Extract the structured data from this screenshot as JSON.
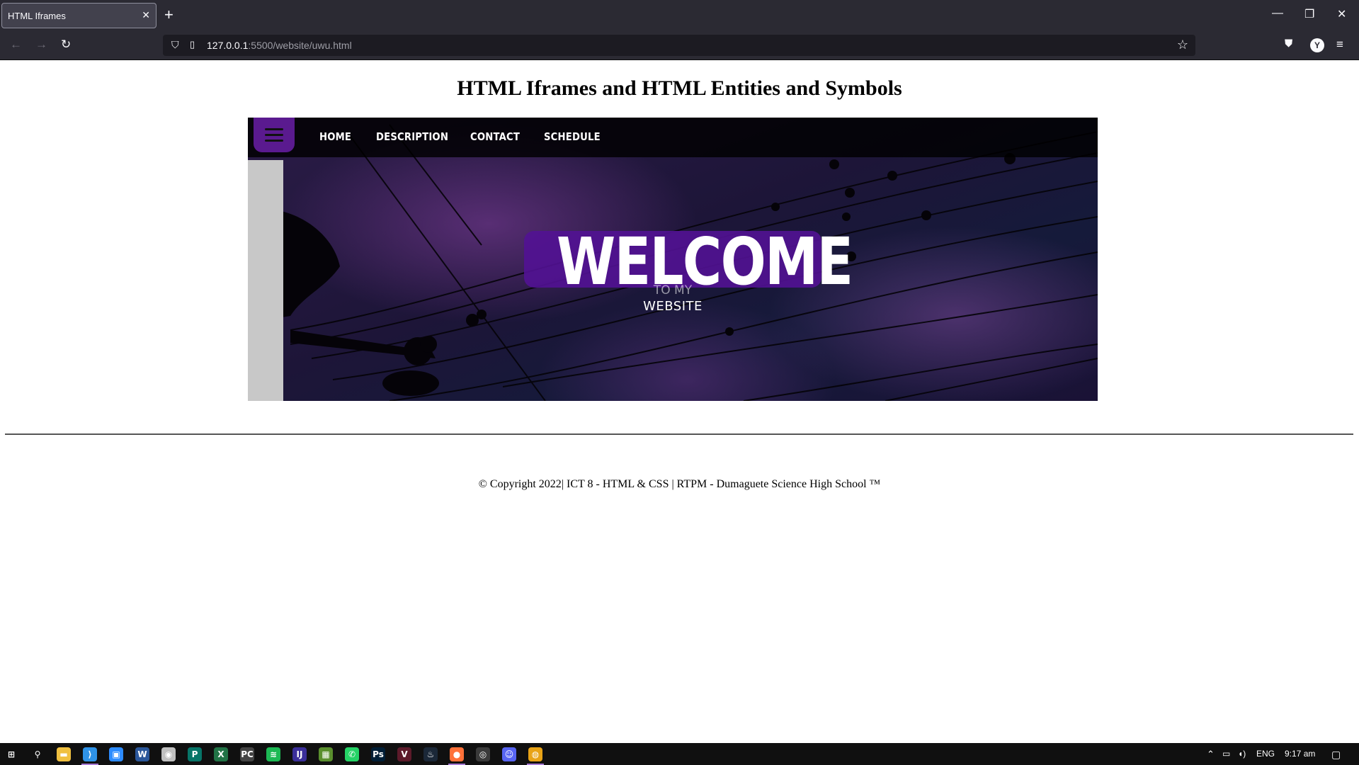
{
  "browser": {
    "tab_title": "HTML Iframes",
    "tab_close": "✕",
    "new_tab": "+",
    "url_host": "127.0.0.1",
    "url_path": ":5500/website/uwu.html",
    "avatar_letter": "Y",
    "window_controls": {
      "minimize": "—",
      "restore": "❐",
      "close": "✕"
    }
  },
  "page": {
    "title": "HTML Iframes and HTML Entities and Symbols",
    "nav": [
      "HOME",
      "DESCRIPTION",
      "CONTACT",
      "SCHEDULE"
    ],
    "hero_title": "WELCOME",
    "hero_sub1": "TO MY",
    "hero_sub2": "WEBSITE",
    "footer": "© Copyright 2022| ICT 8 - HTML & CSS | RTPM - Dumaguete Science High School ™"
  },
  "taskbar": {
    "apps": [
      {
        "name": "start-icon",
        "glyph": "⊞",
        "color": "#ffffff"
      },
      {
        "name": "search-icon",
        "glyph": "⚲",
        "color": "#ffffff"
      },
      {
        "name": "file-explorer-icon",
        "glyph": "▬",
        "color": "#f0c040"
      },
      {
        "name": "vscode-icon",
        "glyph": "⟩",
        "color": "#2f93e8"
      },
      {
        "name": "zoom-icon",
        "glyph": "▣",
        "color": "#2d8cff"
      },
      {
        "name": "word-icon",
        "glyph": "W",
        "color": "#2b579a"
      },
      {
        "name": "davinci-icon",
        "glyph": "◉",
        "color": "#c0c0c0"
      },
      {
        "name": "publisher-icon",
        "glyph": "P",
        "color": "#077568"
      },
      {
        "name": "excel-icon",
        "glyph": "X",
        "color": "#217346"
      },
      {
        "name": "pycharm-icon",
        "glyph": "PC",
        "color": "#444444"
      },
      {
        "name": "spotify-icon",
        "glyph": "≋",
        "color": "#1db954"
      },
      {
        "name": "intellij-icon",
        "glyph": "IJ",
        "color": "#3b2f9a"
      },
      {
        "name": "minecraft-icon",
        "glyph": "▦",
        "color": "#5a8f2e"
      },
      {
        "name": "whatsapp-icon",
        "glyph": "✆",
        "color": "#25d366"
      },
      {
        "name": "photoshop-icon",
        "glyph": "Ps",
        "color": "#001e36"
      },
      {
        "name": "app-v-icon",
        "glyph": "V",
        "color": "#5c1a2a"
      },
      {
        "name": "steam-icon",
        "glyph": "♨",
        "color": "#1b2838"
      },
      {
        "name": "firefox-icon",
        "glyph": "●",
        "color": "#ff7139"
      },
      {
        "name": "obs-icon",
        "glyph": "◎",
        "color": "#3a3a3a"
      },
      {
        "name": "discord-icon",
        "glyph": "☺",
        "color": "#5865f2"
      },
      {
        "name": "chrome-icon",
        "glyph": "◍",
        "color": "#e8a317"
      }
    ],
    "lang": "ENG",
    "time": "9:17 am"
  }
}
